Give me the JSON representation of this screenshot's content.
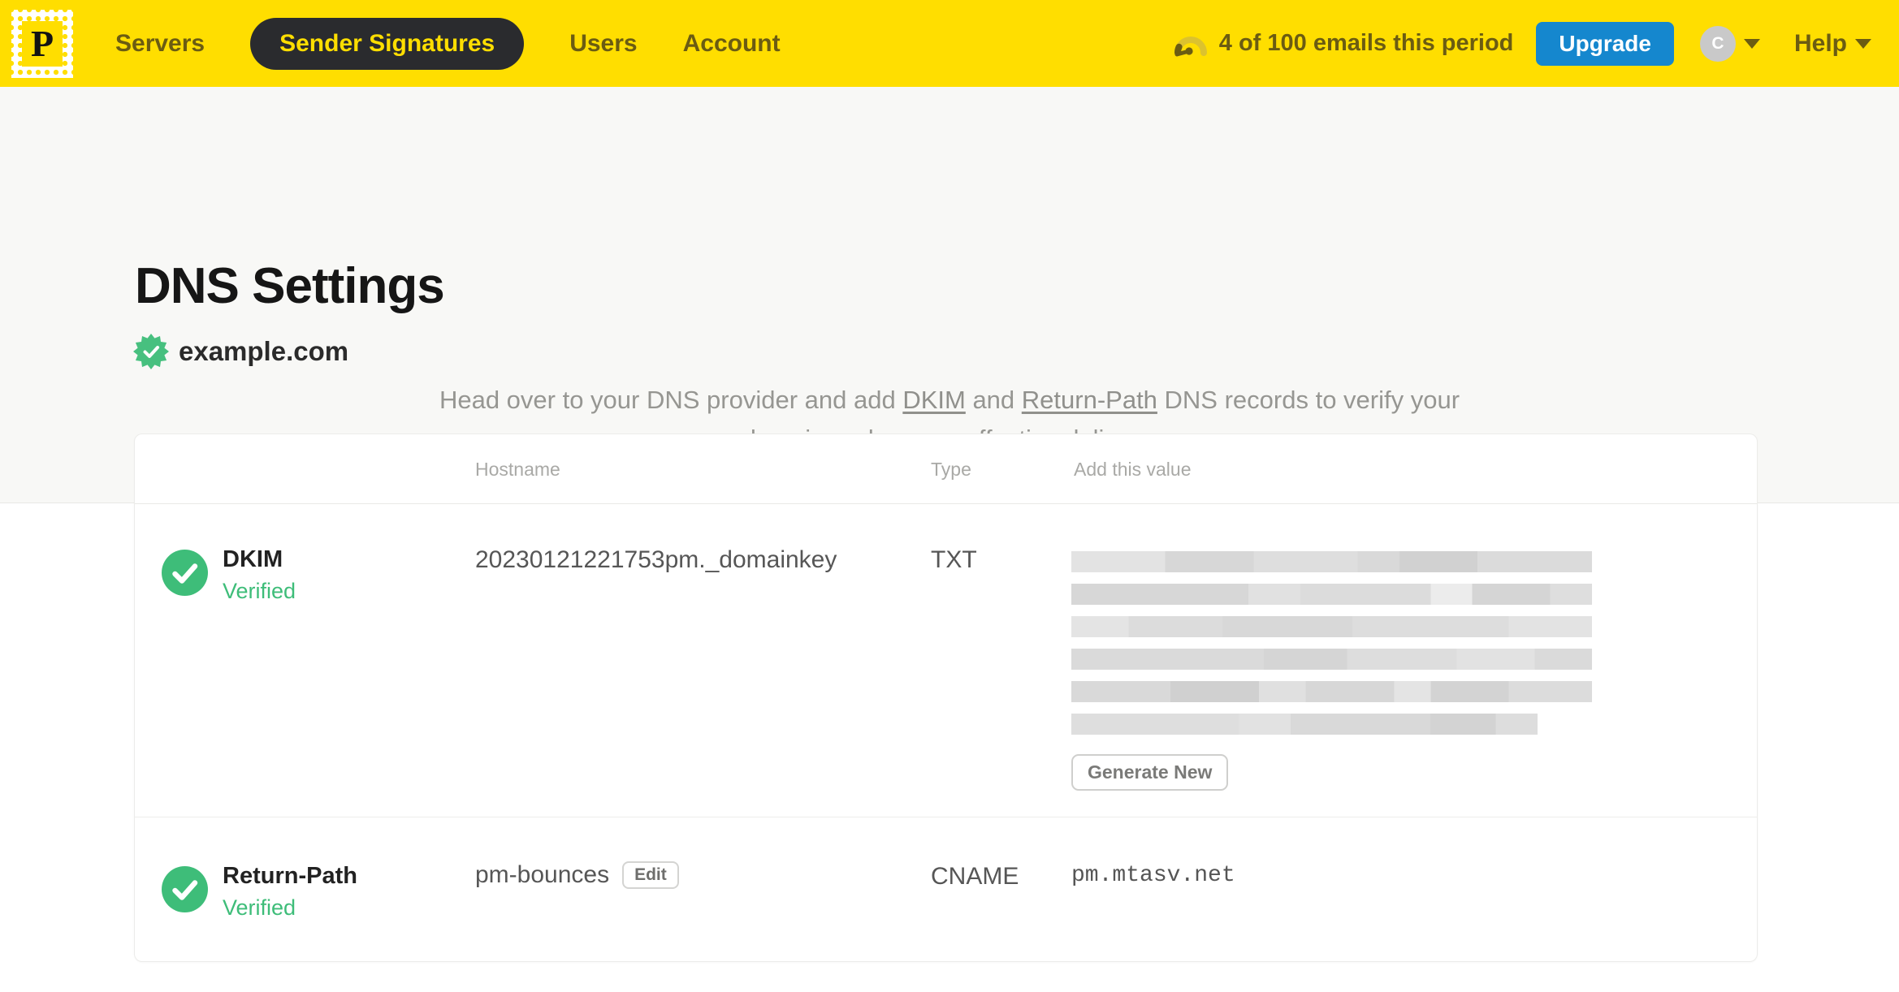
{
  "topbar": {
    "logo_letter": "P",
    "nav": [
      {
        "label": "Servers",
        "active": false
      },
      {
        "label": "Sender Signatures",
        "active": true
      },
      {
        "label": "Users",
        "active": false
      },
      {
        "label": "Account",
        "active": false
      }
    ],
    "usage": "4 of 100 emails this period",
    "usage_icon": "gauge-icon",
    "upgrade_label": "Upgrade",
    "avatar_initial": "C",
    "help_label": "Help"
  },
  "page": {
    "title": "DNS Settings",
    "domain": "example.com",
    "domain_badge_icon": "verified-seal-icon",
    "intro": {
      "lead": "Head over to your DNS provider and add ",
      "link_dkim": "DKIM",
      "mid": " and ",
      "link_return_path": "Return-Path",
      "tail": " DNS records to verify your domain and ensure effective delivery."
    }
  },
  "table": {
    "columns": [
      "Hostname",
      "Type",
      "Add this value"
    ],
    "records": [
      {
        "name": "DKIM",
        "status": "Verified",
        "status_icon": "check-circle-icon",
        "hostname": "20230121221753pm._domainkey",
        "type": "TXT",
        "value_redacted": true,
        "action": "Generate New"
      },
      {
        "name": "Return-Path",
        "status": "Verified",
        "status_icon": "check-circle-icon",
        "hostname": "pm-bounces",
        "hostname_action": "Edit",
        "type": "CNAME",
        "value": "pm.mtasv.net"
      }
    ]
  },
  "colors": {
    "brand_yellow": "#FFDE00",
    "nav_dark": "#6B5C12",
    "active_pill_bg": "#2A2B2E",
    "upgrade_blue": "#1587CE",
    "verified_green": "#3EBD79",
    "redacted_gray": "#DBDBDB"
  }
}
